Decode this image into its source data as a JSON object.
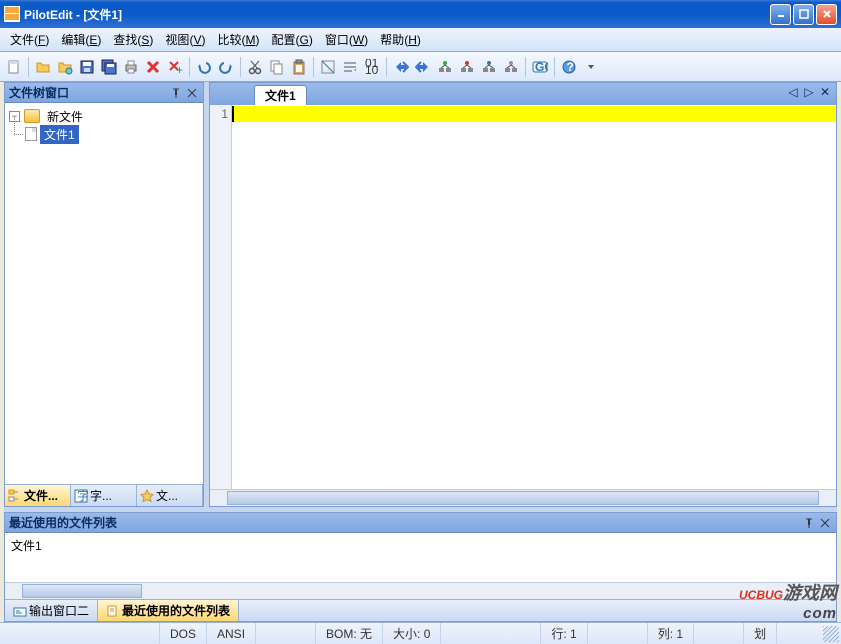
{
  "title": "PilotEdit - [文件1]",
  "menus": {
    "file": "文件",
    "file_mn": "F",
    "edit": "编辑",
    "edit_mn": "E",
    "find": "查找",
    "find_mn": "S",
    "view": "视图",
    "view_mn": "V",
    "compare": "比较",
    "compare_mn": "M",
    "config": "配置",
    "config_mn": "G",
    "window": "窗口",
    "window_mn": "W",
    "help": "帮助",
    "help_mn": "H"
  },
  "sidebar": {
    "title": "文件树窗口",
    "root": "新文件",
    "child": "文件1",
    "tabs": {
      "files": "文件...",
      "chars": "字...",
      "stars": "文..."
    }
  },
  "editor": {
    "tab": "文件1",
    "line_no": "1"
  },
  "bottom": {
    "title": "最近使用的文件列表",
    "item": "文件1",
    "tabs": {
      "output2": "输出窗口二",
      "recent": "最近使用的文件列表"
    }
  },
  "status": {
    "enc1": "DOS",
    "enc2": "ANSI",
    "bom": "BOM: 无",
    "size": "大小: 0",
    "row": "行: 1",
    "col": "列: 1",
    "sel": "划"
  },
  "watermark": {
    "a": "UCBUG",
    "b": "游戏网",
    "c": "com"
  }
}
